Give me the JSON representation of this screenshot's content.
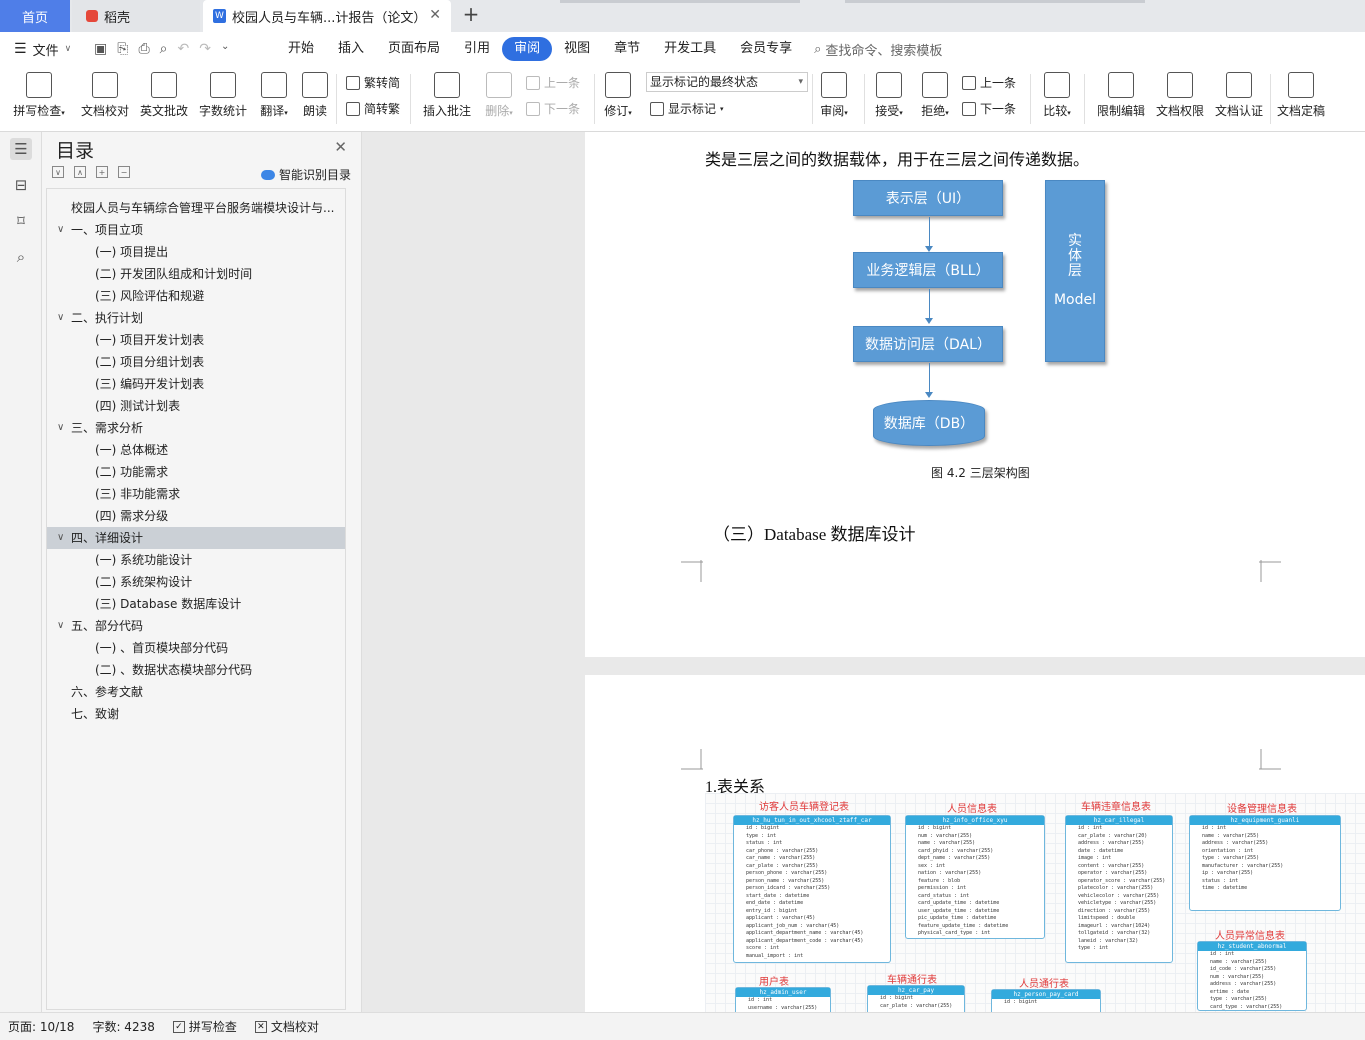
{
  "tabs": {
    "home": "首页",
    "daoke": "稻壳",
    "doc": "校园人员与车辆...计报告（论文）",
    "add": "+"
  },
  "menu": {
    "file": "文件",
    "items": [
      "开始",
      "插入",
      "页面布局",
      "引用",
      "审阅",
      "视图",
      "章节",
      "开发工具",
      "会员专享"
    ],
    "active_index": 4,
    "search": "查找命令、搜索模板"
  },
  "ribbon": {
    "spell": "拼写检查",
    "proof": "文档校对",
    "en_review": "英文批改",
    "wordcount": "字数统计",
    "translate": "翻译",
    "read": "朗读",
    "to_trad": "繁转简",
    "to_simp": "简转繁",
    "insert_comment": "插入批注",
    "delete": "删除",
    "prev": "上一条",
    "next": "下一条",
    "revise": "修订",
    "markup_state": "显示标记的最终状态",
    "show_markup": "显示标记",
    "review": "审阅",
    "accept": "接受",
    "reject": "拒绝",
    "prev2": "上一条",
    "next2": "下一条",
    "compare": "比较",
    "restrict": "限制编辑",
    "permission": "文档权限",
    "auth": "文档认证",
    "final": "文档定稿"
  },
  "toc": {
    "title": "目录",
    "ai": "智能识别目录",
    "items": [
      {
        "text": "校园人员与车辆综合管理平台服务端模块设计与...",
        "level": 0,
        "chev": false
      },
      {
        "text": "一、项目立项",
        "level": 1,
        "chev": true
      },
      {
        "text": "(一) 项目提出",
        "level": 2,
        "chev": false
      },
      {
        "text": "(二) 开发团队组成和计划时间",
        "level": 2,
        "chev": false
      },
      {
        "text": "(三) 风险评估和规避",
        "level": 2,
        "chev": false
      },
      {
        "text": "二、执行计划",
        "level": 1,
        "chev": true
      },
      {
        "text": "(一) 项目开发计划表",
        "level": 2,
        "chev": false
      },
      {
        "text": "(二) 项目分组计划表",
        "level": 2,
        "chev": false
      },
      {
        "text": "(三) 编码开发计划表",
        "level": 2,
        "chev": false
      },
      {
        "text": "(四) 测试计划表",
        "level": 2,
        "chev": false
      },
      {
        "text": "三、需求分析",
        "level": 1,
        "chev": true
      },
      {
        "text": "(一) 总体概述",
        "level": 2,
        "chev": false
      },
      {
        "text": "(二) 功能需求",
        "level": 2,
        "chev": false
      },
      {
        "text": "(三) 非功能需求",
        "level": 2,
        "chev": false
      },
      {
        "text": "(四) 需求分级",
        "level": 2,
        "chev": false
      },
      {
        "text": "四、详细设计",
        "level": 1,
        "chev": true
      },
      {
        "text": "(一) 系统功能设计",
        "level": 2,
        "chev": false
      },
      {
        "text": "(二) 系统架构设计",
        "level": 2,
        "chev": false
      },
      {
        "text": "(三) Database 数据库设计",
        "level": 2,
        "chev": false
      },
      {
        "text": "五、部分代码",
        "level": 1,
        "chev": true
      },
      {
        "text": "(一) 、首页模块部分代码",
        "level": 2,
        "chev": false
      },
      {
        "text": "(二) 、数据状态模块部分代码",
        "level": 2,
        "chev": false
      },
      {
        "text": "六、参考文献",
        "level": 1,
        "chev": false
      },
      {
        "text": "七、致谢",
        "level": 1,
        "chev": false
      }
    ],
    "selected_index": 15
  },
  "doc": {
    "para1": "类是三层之间的数据载体，用于在三层之间传递数据。",
    "box_ui": "表示层（UI）",
    "box_bll": "业务逻辑层（BLL）",
    "box_dal": "数据访问层（DAL）",
    "box_db": "数据库（DB）",
    "entity_1": "实",
    "entity_2": "体",
    "entity_3": "层",
    "entity_model": "Model",
    "caption": "图 4.2  三层架构图",
    "heading": "（三）Database 数据库设计",
    "table_rel": "1.表关系"
  },
  "er": {
    "t1_title": "访客人员车辆登记表",
    "t1_name": "hz_hu_tun_in_out_xhcool_ztaff_car",
    "t2_title": "人员信息表",
    "t2_name": "hz_info_office_xyu",
    "t3_title": "车辆违章信息表",
    "t3_name": "hz_car_illegal",
    "t4_title": "设备管理信息表",
    "t4_name": "hz_equipment_guanli",
    "t5_title": "人员异常信息表",
    "t5_name": "hz_student_abnormal",
    "t6_title": "用户表",
    "t6_name": "hz_admin_user",
    "t7_title": "车辆通行表",
    "t7_name": "hz_car_pay",
    "t8_title": "人员通行表",
    "t8_name": "hz_person_pay_card",
    "t1_rows": [
      "id : bigint",
      "type : int",
      "status : int",
      "car_phone : varchar(255)",
      "car_name : varchar(255)",
      "car_plate : varchar(255)",
      "person_phone : varchar(255)",
      "person_name : varchar(255)",
      "person_idcard : varchar(255)",
      "start_date : datetime",
      "end_date : datetime",
      "entry_id : bigint",
      "applicant : varchar(45)",
      "applicant_job_num : varchar(45)",
      "applicant_department_name : varchar(45)",
      "applicant_department_code : varchar(45)",
      "score : int",
      "manual_import : int"
    ],
    "t2_rows": [
      "id : bigint",
      "num : varchar(255)",
      "name : varchar(255)",
      "card_phyid : varchar(255)",
      "dept_name : varchar(255)",
      "sex : int",
      "nation : varchar(255)",
      "feature : blob",
      "permission : int",
      "card_status : int",
      "card_update_time : datetime",
      "user_update_time : datetime",
      "pic_update_time : datetime",
      "feature_update_time : datetime",
      "physical_card_type : int"
    ],
    "t3_rows": [
      "id : int",
      "car_plate : varchar(20)",
      "address : varchar(255)",
      "date : datetime",
      "image : int",
      "content : varchar(255)",
      "operator : varchar(255)",
      "operator_score : varchar(255)",
      "platecolor : varchar(255)",
      "vehiclecolor : varchar(255)",
      "vehicletype : varchar(255)",
      "direction : varchar(255)",
      "limitspeed : double",
      "imageurl : varchar(1024)",
      "tollgateid : varchar(32)",
      "laneid : varchar(32)",
      "type : int"
    ],
    "t4_rows": [
      "id : int",
      "name : varchar(255)",
      "address : varchar(255)",
      "orientation : int",
      "type : varchar(255)",
      "manufacturer : varchar(255)",
      "ip : varchar(255)",
      "status : int",
      "time : datetime"
    ],
    "t5_rows": [
      "id : int",
      "name : varchar(255)",
      "id_code : varchar(255)",
      "num : varchar(255)",
      "address : varchar(255)",
      "ertime : date",
      "type : varchar(255)",
      "card_type : varchar(255)"
    ],
    "t6_rows": [
      "id : int",
      "username : varchar(255)"
    ],
    "t7_rows": [
      "id : bigint",
      "car_plate : varchar(255)"
    ],
    "t8_rows": [
      "id : bigint"
    ]
  },
  "status": {
    "page": "页面: 10/18",
    "words": "字数: 4238",
    "spell": "拼写检查",
    "proof": "文档校对"
  },
  "colors": {
    "accent": "#2f6fe0",
    "box": "#5b9bd5",
    "home_tab": "#4f7ee8",
    "er_title": "#e03a3a",
    "er_header": "#33aadd"
  }
}
